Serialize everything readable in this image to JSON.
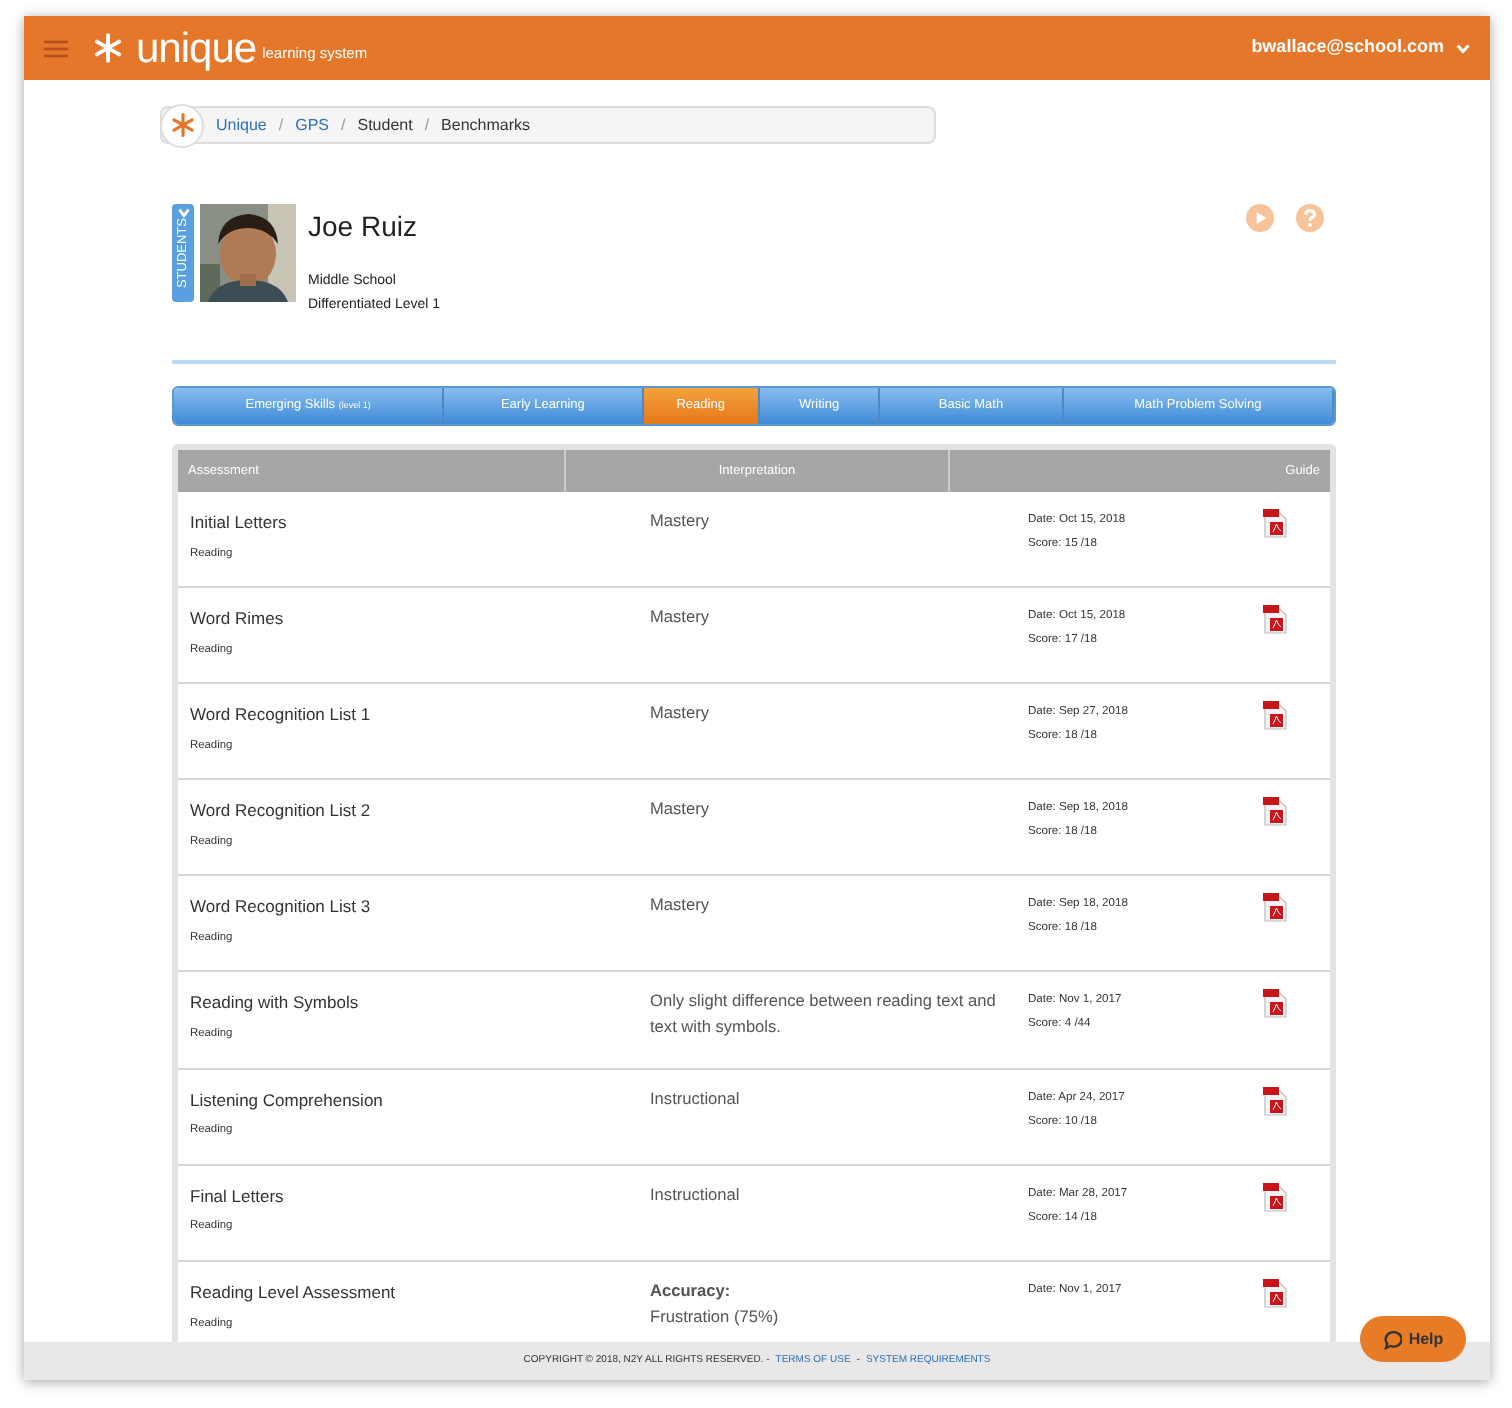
{
  "header": {
    "brand": "unique",
    "tagline": "learning system",
    "user": "bwallace@school.com"
  },
  "breadcrumb_separator": "/",
  "breadcrumb": [
    {
      "label": "Unique",
      "link": true
    },
    {
      "label": "GPS",
      "link": true
    },
    {
      "label": "Student",
      "link": false
    },
    {
      "label": "Benchmarks",
      "link": false
    }
  ],
  "students_tab": "STUDENTS",
  "student": {
    "name": "Joe Ruiz",
    "school": "Middle School",
    "level": "Differentiated Level 1"
  },
  "tabs": [
    {
      "label": "Emerging Skills",
      "note": "(level 1)",
      "selected": false
    },
    {
      "label": "Early Learning",
      "selected": false
    },
    {
      "label": "Reading",
      "selected": true
    },
    {
      "label": "Writing",
      "selected": false
    },
    {
      "label": "Basic Math",
      "selected": false
    },
    {
      "label": "Math Problem Solving",
      "selected": false
    }
  ],
  "table": {
    "columns": [
      "Assessment",
      "Interpretation",
      "Guide"
    ],
    "rows": [
      {
        "name": "Initial Letters",
        "category": "Reading",
        "interpretation": [
          {
            "kind": "plain",
            "text": "Mastery"
          }
        ],
        "date": "Date: Oct 15, 2018",
        "score": "Score: 15 /18"
      },
      {
        "name": "Word Rimes",
        "category": "Reading",
        "interpretation": [
          {
            "kind": "plain",
            "text": "Mastery"
          }
        ],
        "date": "Date: Oct 15, 2018",
        "score": "Score: 17 /18"
      },
      {
        "name": "Word Recognition List 1",
        "category": "Reading",
        "interpretation": [
          {
            "kind": "plain",
            "text": "Mastery"
          }
        ],
        "date": "Date: Sep 27, 2018",
        "score": "Score: 18 /18"
      },
      {
        "name": "Word Recognition List 2",
        "category": "Reading",
        "interpretation": [
          {
            "kind": "plain",
            "text": "Mastery"
          }
        ],
        "date": "Date: Sep 18, 2018",
        "score": "Score: 18 /18"
      },
      {
        "name": "Word Recognition List 3",
        "category": "Reading",
        "interpretation": [
          {
            "kind": "plain",
            "text": "Mastery"
          }
        ],
        "date": "Date: Sep 18, 2018",
        "score": "Score: 18 /18"
      },
      {
        "name": "Reading with Symbols",
        "category": "Reading",
        "interpretation": [
          {
            "kind": "plain",
            "text": "Only slight difference between reading text and text with symbols."
          }
        ],
        "date": "Date: Nov 1, 2017",
        "score": "Score: 4 /44"
      },
      {
        "name": "Listening Comprehension",
        "category": "Reading",
        "interpretation": [
          {
            "kind": "plain",
            "text": "Instructional"
          }
        ],
        "date": "Date: Apr 24, 2017",
        "score": "Score: 10 /18"
      },
      {
        "name": "Final Letters",
        "category": "Reading",
        "interpretation": [
          {
            "kind": "plain",
            "text": "Instructional"
          }
        ],
        "date": "Date: Mar 28, 2017",
        "score": "Score: 14 /18"
      },
      {
        "name": "Reading Level Assessment",
        "category": "Reading",
        "interpretation": [
          {
            "kind": "heading",
            "text": "Accuracy:"
          },
          {
            "kind": "plain",
            "text": "Frustration (75%)"
          }
        ],
        "date": "Date: Nov 1, 2017"
      }
    ]
  },
  "footer": {
    "copyright": "COPYRIGHT © 2018, N2Y ALL RIGHTS RESERVED. -",
    "links": [
      "TERMS OF USE",
      "SYSTEM REQUIREMENTS"
    ],
    "separator": "-"
  },
  "help_button": "Help"
}
